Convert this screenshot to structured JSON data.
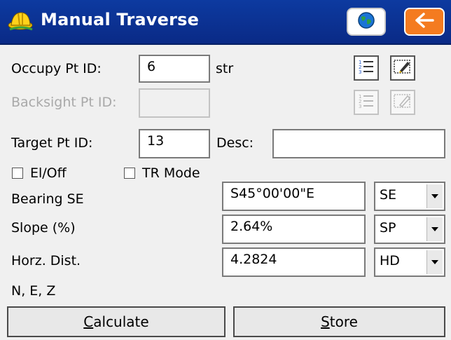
{
  "titlebar": {
    "title": "Manual Traverse",
    "app_icon": "hardhat-icon",
    "globe_icon": "globe-icon",
    "back_icon": "arrow-left-icon",
    "colors": {
      "bar": "#0d3aa0",
      "back_button": "#f47b20"
    }
  },
  "occupy": {
    "label": "Occupy Pt ID:",
    "value": "6",
    "suffix": "str"
  },
  "backsight": {
    "label": "Backsight Pt ID:",
    "value": ""
  },
  "target": {
    "label": "Target Pt ID:",
    "value": "13",
    "desc_label": "Desc:",
    "desc_value": ""
  },
  "toolbar": {
    "list_icon": "numbered-list-icon",
    "edit_icon": "edit-point-icon"
  },
  "options": {
    "eloff": {
      "label": "El/Off",
      "checked": false
    },
    "trmode": {
      "label": "TR Mode",
      "checked": false
    }
  },
  "bearing": {
    "label": "Bearing SE",
    "value": "S45°00'00\"E",
    "mode": "SE"
  },
  "slope": {
    "label": "Slope (%)",
    "value": "2.64%",
    "mode": "SP"
  },
  "horz": {
    "label": "Horz. Dist.",
    "value": "4.2824",
    "mode": "HD"
  },
  "nez": {
    "label": "N, E, Z"
  },
  "buttons": {
    "calculate_first": "C",
    "calculate_rest": "alculate",
    "store_first": "S",
    "store_rest": "tore"
  }
}
